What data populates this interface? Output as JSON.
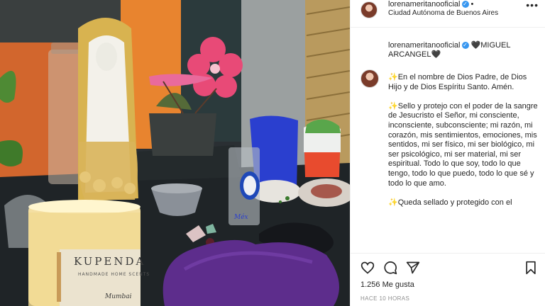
{
  "post": {
    "username": "lorenameritanooficial",
    "dot": "•",
    "location": "Ciudad Autónoma de Buenos Aires",
    "more_icon": "•••"
  },
  "caption": {
    "username": "lorenameritanooficial",
    "title": "🖤MIGUEL ARCANGEL🖤",
    "paragraphs": [
      "✨En el nombre de Dios Padre, de Dios Hijo y de Dios Espíritu Santo. Amén.",
      "✨Sello y protejo con el poder de la sangre de Jesucristo el Señor, mi consciente, inconsciente, subconsciente; mi razón, mi corazón, mis sentimientos, emociones, mis sentidos, mi ser físico, mi ser biológico, mi ser psicológico, mi ser material, mi ser espiritual. Todo lo que soy, todo lo que tengo, todo lo que puedo, todo lo que sé y todo lo que amo.",
      "✨Queda sellado y protegido con el"
    ]
  },
  "icons": {
    "verified": "verified-badge-icon",
    "like": "heart-icon",
    "comment": "comment-icon",
    "share": "send-icon",
    "save": "bookmark-icon",
    "more": "more-options-icon"
  },
  "candle": {
    "brand": "KUPENDA",
    "subtitle": "HANDMADE HOME SCENTS",
    "scent": "Mumbai"
  },
  "cup_label": "Méx",
  "stats": {
    "likes": "1.256 Me gusta",
    "time": "HACE 10 HORAS"
  },
  "colors": {
    "verified": "#3897f0",
    "text": "#262626",
    "muted": "#8e8e8e",
    "border": "#efefef"
  }
}
